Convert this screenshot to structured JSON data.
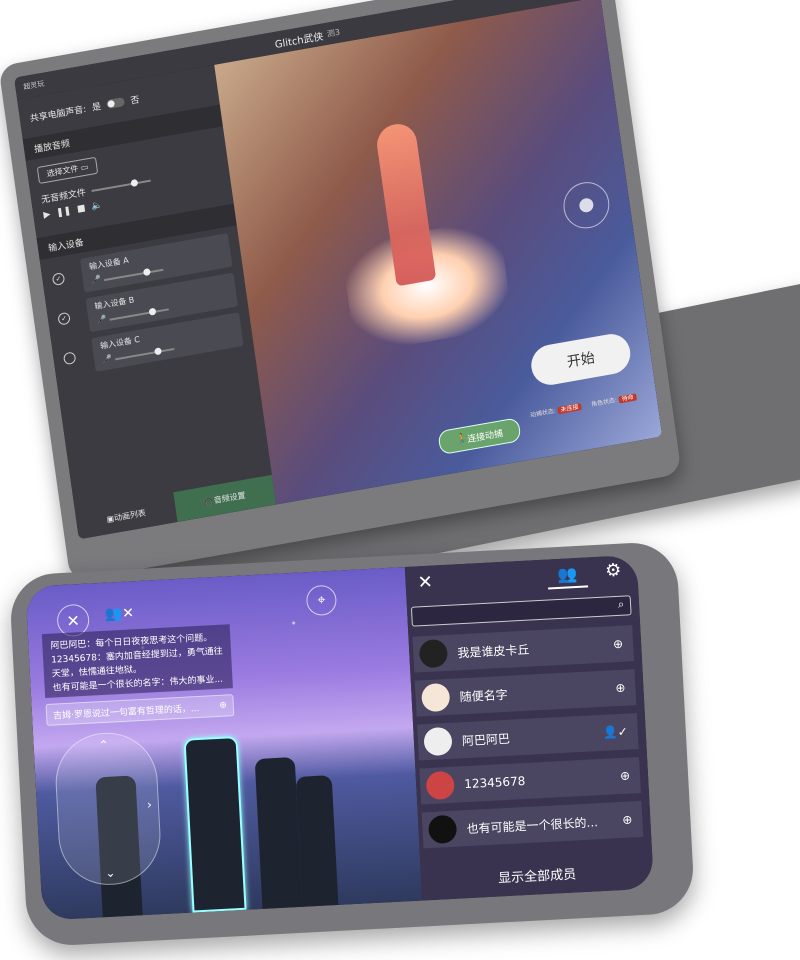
{
  "laptop": {
    "window_title": "Glitch武侠",
    "window_subtitle": "测3",
    "logo_text": "超灵玩",
    "window_controls": "– ▢ ✕",
    "share_audio_label": "共享电脑声音:",
    "share_audio_yes": "是",
    "share_audio_no": "否",
    "playback_section": "播放音频",
    "choose_file_label": "选择文件",
    "no_file_text": "无音频文件",
    "input_section": "输入设备",
    "devices": [
      {
        "label": "输入设备 A",
        "selected": true
      },
      {
        "label": "输入设备 B",
        "selected": true
      },
      {
        "label": "输入设备 C",
        "selected": false
      }
    ],
    "tab_action_list": "动画列表",
    "tab_audio_settings": "音频设置",
    "connect_button": "连接动捕",
    "start_button": "开始",
    "status": {
      "motion_label": "动捕状态:",
      "motion_value": "未连接",
      "role_label": "角色状态:",
      "role_value": "待命"
    }
  },
  "phone": {
    "chat_messages": [
      "阿巴阿巴：每个日日夜夜思考这个问题。",
      "12345678：塞内加音经提到过，勇气通往天堂，怯懦通往地狱。",
      "也有可能是一个很长的名字：伟大的事业..."
    ],
    "chat_input_value": "吉姆·罗恩说过一句富有哲理的话，...",
    "members": [
      {
        "name": "我是谁皮卡丘",
        "action": "add",
        "avatar_color": "#222"
      },
      {
        "name": "随便名字",
        "action": "add",
        "avatar_color": "#f5e6d8"
      },
      {
        "name": "阿巴阿巴",
        "action": "added",
        "avatar_color": "#eeeeee"
      },
      {
        "name": "12345678",
        "action": "add",
        "avatar_color": "#c44"
      },
      {
        "name": "也有可能是一个很长的...",
        "action": "add",
        "avatar_color": "#111"
      }
    ],
    "show_all_label": "显示全部成员"
  }
}
